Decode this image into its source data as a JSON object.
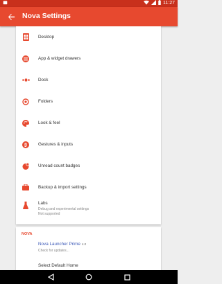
{
  "status_bar": {
    "time": "11:27"
  },
  "app_bar": {
    "title": "Nova Settings"
  },
  "menu": [
    {
      "label": "Desktop",
      "icon": "desktop-icon"
    },
    {
      "label": "App & widget drawers",
      "icon": "drawer-icon"
    },
    {
      "label": "Dock",
      "icon": "dock-icon"
    },
    {
      "label": "Folders",
      "icon": "folder-icon"
    },
    {
      "label": "Look & feel",
      "icon": "palette-icon"
    },
    {
      "label": "Gestures & inputs",
      "icon": "gesture-icon"
    },
    {
      "label": "Unread count badges",
      "icon": "badge-icon"
    },
    {
      "label": "Backup & import settings",
      "icon": "backup-icon"
    },
    {
      "label": "Labs",
      "sub1": "Debug and experimental settings",
      "sub2": "Not supported",
      "icon": "labs-icon"
    }
  ],
  "nova_section": {
    "header": "NOVA",
    "prime_title": "Nova Launcher Prime",
    "version": "4.0",
    "prime_sub": "Check for updates...",
    "default_home": "Select Default Home"
  },
  "colors": {
    "primary": "#e7492f",
    "status_bar": "#c8301c",
    "link": "#3d5ab8"
  }
}
